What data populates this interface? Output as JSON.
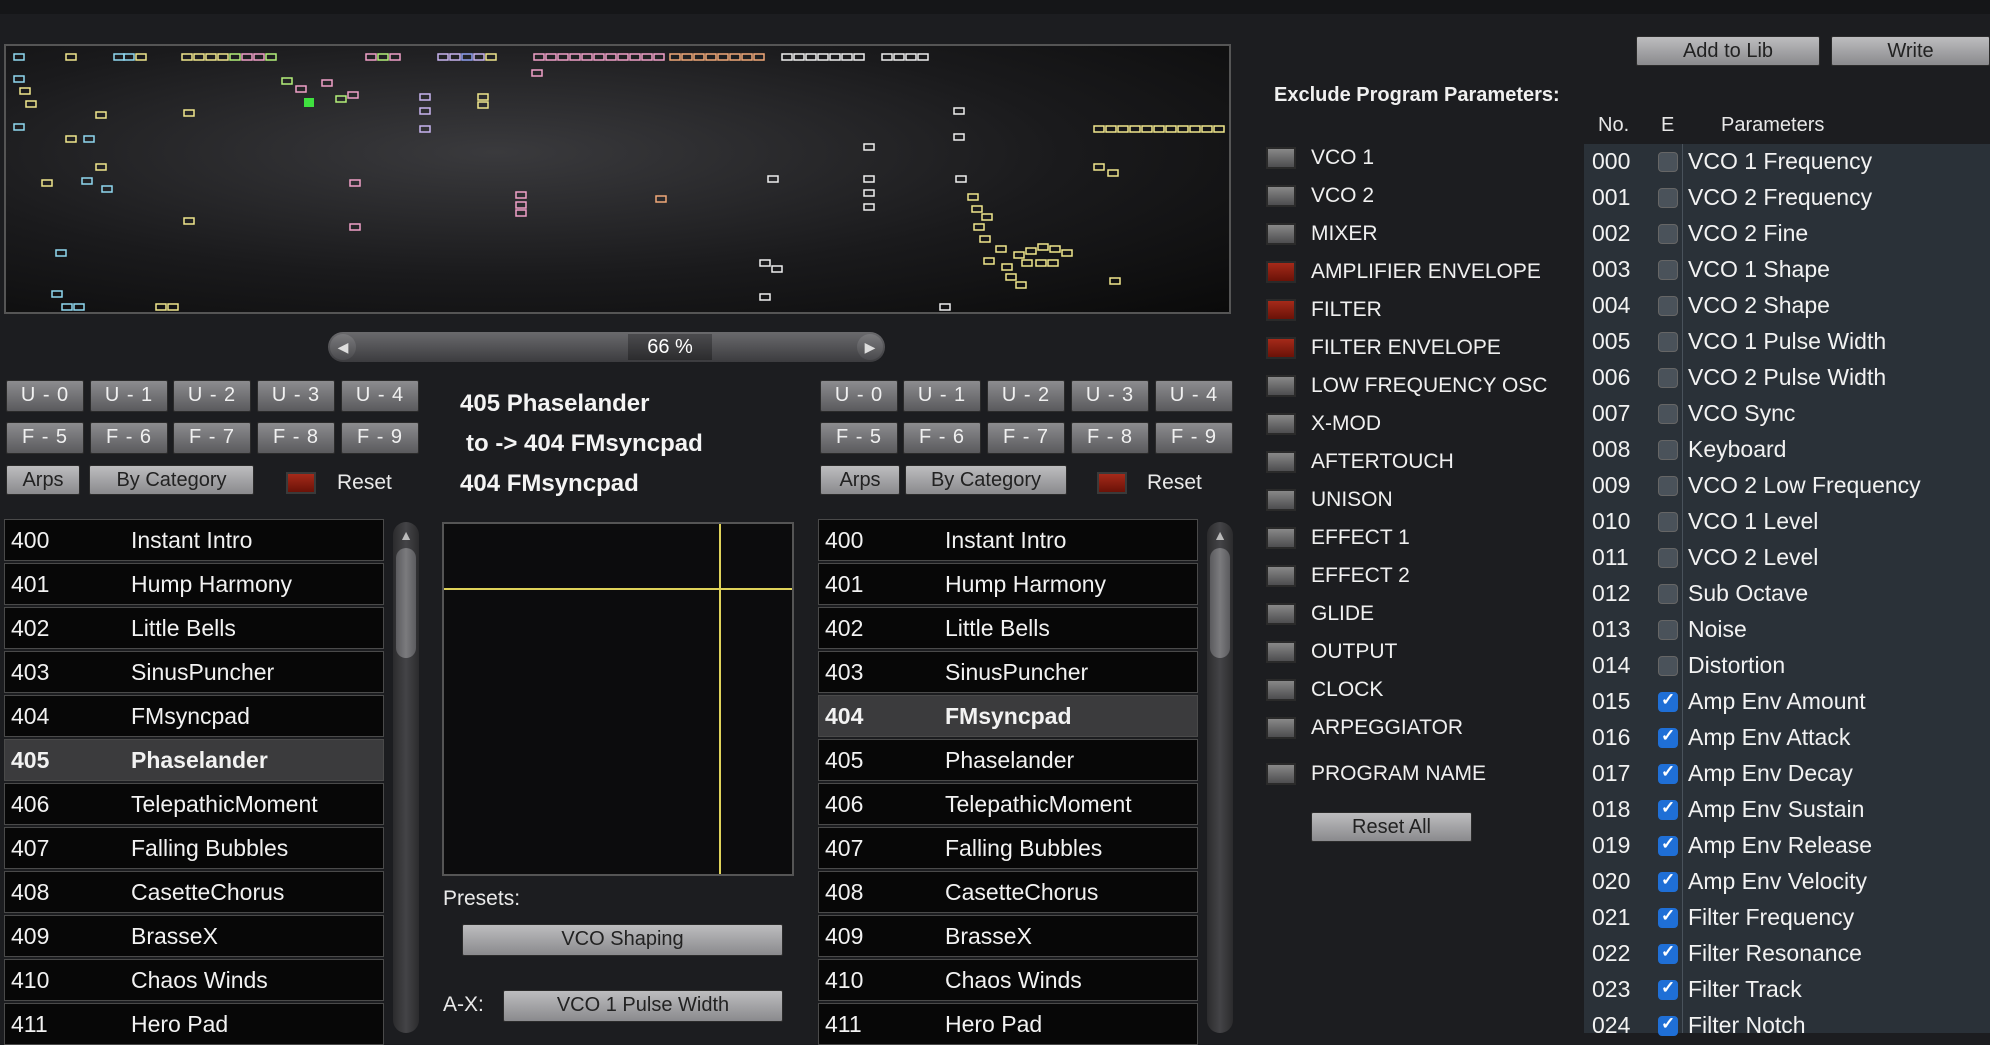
{
  "scroll": {
    "zoom": "66 %",
    "left_arrow": "◀",
    "right_arrow": "▶"
  },
  "left_panel": {
    "u_buttons": [
      "U - 0",
      "U - 1",
      "U - 2",
      "U - 3",
      "U - 4"
    ],
    "f_buttons": [
      "F - 5",
      "F - 6",
      "F - 7",
      "F - 8",
      "F - 9"
    ],
    "arps": "Arps",
    "by_category": "By Category",
    "reset": "Reset"
  },
  "right_panel": {
    "u_buttons": [
      "U - 0",
      "U - 1",
      "U - 2",
      "U - 3",
      "U - 4"
    ],
    "f_buttons": [
      "F - 5",
      "F - 6",
      "F - 7",
      "F - 8",
      "F - 9"
    ],
    "arps": "Arps",
    "by_category": "By Category",
    "reset": "Reset"
  },
  "transfer": {
    "source": "405  Phaselander",
    "target": "to -> 404  FMsyncpad",
    "dest": "404  FMsyncpad",
    "presets_label": "Presets:",
    "preset_value": "VCO Shaping",
    "ax_label": "A-X:",
    "ax_value": "VCO 1 Pulse Width"
  },
  "left_list": [
    {
      "num": "400",
      "name": "Instant Intro"
    },
    {
      "num": "401",
      "name": "Hump Harmony"
    },
    {
      "num": "402",
      "name": "Little Bells"
    },
    {
      "num": "403",
      "name": "SinusPuncher"
    },
    {
      "num": "404",
      "name": "FMsyncpad"
    },
    {
      "num": "405",
      "name": "Phaselander"
    },
    {
      "num": "406",
      "name": "TelepathicMoment"
    },
    {
      "num": "407",
      "name": "Falling Bubbles"
    },
    {
      "num": "408",
      "name": "CasetteChorus"
    },
    {
      "num": "409",
      "name": "BrasseX"
    },
    {
      "num": "410",
      "name": "Chaos Winds"
    },
    {
      "num": "411",
      "name": "Hero Pad"
    }
  ],
  "left_selected": "405",
  "right_list": [
    {
      "num": "400",
      "name": "Instant Intro"
    },
    {
      "num": "401",
      "name": "Hump Harmony"
    },
    {
      "num": "402",
      "name": "Little Bells"
    },
    {
      "num": "403",
      "name": "SinusPuncher"
    },
    {
      "num": "404",
      "name": "FMsyncpad"
    },
    {
      "num": "405",
      "name": "Phaselander"
    },
    {
      "num": "406",
      "name": "TelepathicMoment"
    },
    {
      "num": "407",
      "name": "Falling Bubbles"
    },
    {
      "num": "408",
      "name": "CasetteChorus"
    },
    {
      "num": "409",
      "name": "BrasseX"
    },
    {
      "num": "410",
      "name": "Chaos Winds"
    },
    {
      "num": "411",
      "name": "Hero Pad"
    }
  ],
  "right_selected": "404",
  "top_buttons": {
    "add_to_lib": "Add to Lib",
    "write": "Write"
  },
  "exclude": {
    "heading": "Exclude Program Parameters:",
    "groups": [
      {
        "name": "VCO 1",
        "on": false
      },
      {
        "name": "VCO 2",
        "on": false
      },
      {
        "name": "MIXER",
        "on": false
      },
      {
        "name": "AMPLIFIER ENVELOPE",
        "on": true
      },
      {
        "name": "FILTER",
        "on": true
      },
      {
        "name": "FILTER ENVELOPE",
        "on": true
      },
      {
        "name": "LOW FREQUENCY OSC",
        "on": false
      },
      {
        "name": "X-MOD",
        "on": false
      },
      {
        "name": "AFTERTOUCH",
        "on": false
      },
      {
        "name": "UNISON",
        "on": false
      },
      {
        "name": "EFFECT 1",
        "on": false
      },
      {
        "name": "EFFECT 2",
        "on": false
      },
      {
        "name": "GLIDE",
        "on": false
      },
      {
        "name": "OUTPUT",
        "on": false
      },
      {
        "name": "CLOCK",
        "on": false
      },
      {
        "name": "ARPEGGIATOR",
        "on": false
      },
      {
        "name": "PROGRAM NAME",
        "on": false
      }
    ],
    "reset_all": "Reset All"
  },
  "params": {
    "col_no": "No.",
    "col_e": "E",
    "col_params": "Parameters",
    "rows": [
      {
        "no": "000",
        "e": false,
        "name": "VCO 1 Frequency"
      },
      {
        "no": "001",
        "e": false,
        "name": "VCO 2 Frequency"
      },
      {
        "no": "002",
        "e": false,
        "name": "VCO 2 Fine"
      },
      {
        "no": "003",
        "e": false,
        "name": "VCO 1 Shape"
      },
      {
        "no": "004",
        "e": false,
        "name": "VCO 2 Shape"
      },
      {
        "no": "005",
        "e": false,
        "name": "VCO 1 Pulse Width"
      },
      {
        "no": "006",
        "e": false,
        "name": "VCO 2 Pulse Width"
      },
      {
        "no": "007",
        "e": false,
        "name": "VCO Sync"
      },
      {
        "no": "008",
        "e": false,
        "name": "Keyboard"
      },
      {
        "no": "009",
        "e": false,
        "name": "VCO 2 Low Frequency"
      },
      {
        "no": "010",
        "e": false,
        "name": "VCO 1 Level"
      },
      {
        "no": "011",
        "e": false,
        "name": "VCO 2 Level"
      },
      {
        "no": "012",
        "e": false,
        "name": "Sub Octave"
      },
      {
        "no": "013",
        "e": false,
        "name": "Noise"
      },
      {
        "no": "014",
        "e": false,
        "name": "Distortion"
      },
      {
        "no": "015",
        "e": true,
        "name": "Amp Env Amount"
      },
      {
        "no": "016",
        "e": true,
        "name": "Amp Env Attack"
      },
      {
        "no": "017",
        "e": true,
        "name": "Amp Env Decay"
      },
      {
        "no": "018",
        "e": true,
        "name": "Amp Env Sustain"
      },
      {
        "no": "019",
        "e": true,
        "name": "Amp Env Release"
      },
      {
        "no": "020",
        "e": true,
        "name": "Amp Env Velocity"
      },
      {
        "no": "021",
        "e": true,
        "name": "Filter Frequency"
      },
      {
        "no": "022",
        "e": true,
        "name": "Filter Resonance"
      },
      {
        "no": "023",
        "e": true,
        "name": "Filter Track"
      },
      {
        "no": "024",
        "e": true,
        "name": "Filter Notch"
      }
    ]
  },
  "colors": {
    "led_on": "#a52a1a",
    "check_on": "#1f6fd6",
    "plot_line": "#e0d35a"
  }
}
